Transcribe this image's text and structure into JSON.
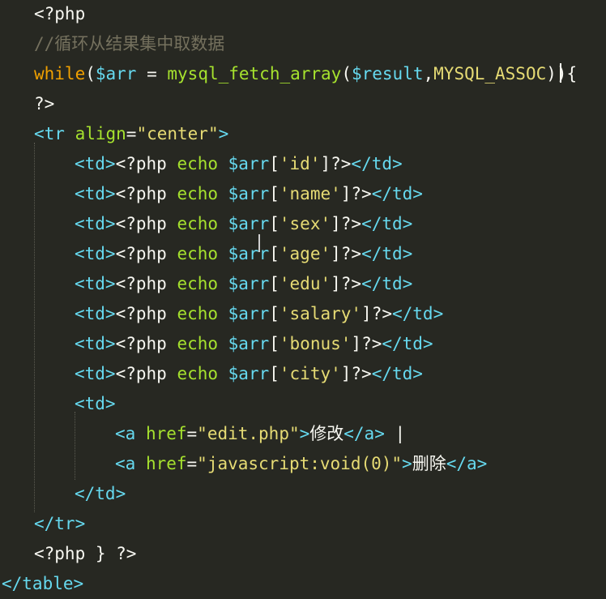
{
  "editor": {
    "theme": {
      "background": "#272822",
      "text": "#f8f8f2",
      "comment": "#75715e",
      "keyword": "#f0a000",
      "variable": "#66d9ef",
      "function": "#a6e22e",
      "tag": "#66d9ef",
      "attribute": "#a6e22e",
      "string": "#e6db74"
    },
    "lines": [
      {
        "indent": 1,
        "tokens": [
          {
            "t": "php",
            "v": "<?php"
          }
        ]
      },
      {
        "indent": 1,
        "tokens": [
          {
            "t": "comment",
            "v": "//循环从结果集中取数据"
          }
        ]
      },
      {
        "indent": 1,
        "tokens": [
          {
            "t": "kw",
            "v": "while"
          },
          {
            "t": "punct",
            "v": "("
          },
          {
            "t": "var",
            "v": "$arr"
          },
          {
            "t": "punct",
            "v": " = "
          },
          {
            "t": "fn",
            "v": "mysql_fetch_array"
          },
          {
            "t": "punct",
            "v": "("
          },
          {
            "t": "var",
            "v": "$result"
          },
          {
            "t": "punct",
            "v": ","
          },
          {
            "t": "str",
            "v": "MYSQL_ASSOC"
          },
          {
            "t": "punct",
            "v": ")){"
          }
        ]
      },
      {
        "indent": 1,
        "tokens": [
          {
            "t": "php",
            "v": "?>"
          }
        ]
      },
      {
        "indent": 1,
        "tokens": [
          {
            "t": "tag",
            "v": "<tr "
          },
          {
            "t": "attr",
            "v": "align"
          },
          {
            "t": "punct",
            "v": "="
          },
          {
            "t": "str",
            "v": "\"center\""
          },
          {
            "t": "tag",
            "v": ">"
          }
        ]
      },
      {
        "indent": 2,
        "tokens": [
          {
            "t": "tag",
            "v": "<td>"
          },
          {
            "t": "php",
            "v": "<?php "
          },
          {
            "t": "fn",
            "v": "echo "
          },
          {
            "t": "var",
            "v": "$arr"
          },
          {
            "t": "punct",
            "v": "["
          },
          {
            "t": "str",
            "v": "'id'"
          },
          {
            "t": "punct",
            "v": "]"
          },
          {
            "t": "php",
            "v": "?>"
          },
          {
            "t": "tag",
            "v": "</td>"
          }
        ]
      },
      {
        "indent": 2,
        "tokens": [
          {
            "t": "tag",
            "v": "<td>"
          },
          {
            "t": "php",
            "v": "<?php "
          },
          {
            "t": "fn",
            "v": "echo "
          },
          {
            "t": "var",
            "v": "$arr"
          },
          {
            "t": "punct",
            "v": "["
          },
          {
            "t": "str",
            "v": "'name'"
          },
          {
            "t": "punct",
            "v": "]"
          },
          {
            "t": "php",
            "v": "?>"
          },
          {
            "t": "tag",
            "v": "</td>"
          }
        ]
      },
      {
        "indent": 2,
        "tokens": [
          {
            "t": "tag",
            "v": "<td>"
          },
          {
            "t": "php",
            "v": "<?php "
          },
          {
            "t": "fn",
            "v": "echo "
          },
          {
            "t": "var",
            "v": "$arr"
          },
          {
            "t": "punct",
            "v": "["
          },
          {
            "t": "str",
            "v": "'sex'"
          },
          {
            "t": "punct",
            "v": "]"
          },
          {
            "t": "php",
            "v": "?>"
          },
          {
            "t": "tag",
            "v": "</td>"
          }
        ]
      },
      {
        "indent": 2,
        "tokens": [
          {
            "t": "tag",
            "v": "<td>"
          },
          {
            "t": "php",
            "v": "<?php "
          },
          {
            "t": "fn",
            "v": "echo "
          },
          {
            "t": "var",
            "v": "$arr"
          },
          {
            "t": "punct",
            "v": "["
          },
          {
            "t": "str",
            "v": "'age'"
          },
          {
            "t": "punct",
            "v": "]"
          },
          {
            "t": "php",
            "v": "?>"
          },
          {
            "t": "tag",
            "v": "</td>"
          }
        ]
      },
      {
        "indent": 2,
        "tokens": [
          {
            "t": "tag",
            "v": "<td>"
          },
          {
            "t": "php",
            "v": "<?php "
          },
          {
            "t": "fn",
            "v": "echo "
          },
          {
            "t": "var",
            "v": "$arr"
          },
          {
            "t": "punct",
            "v": "["
          },
          {
            "t": "str",
            "v": "'edu'"
          },
          {
            "t": "punct",
            "v": "]"
          },
          {
            "t": "php",
            "v": "?>"
          },
          {
            "t": "tag",
            "v": "</td>"
          }
        ]
      },
      {
        "indent": 2,
        "tokens": [
          {
            "t": "tag",
            "v": "<td>"
          },
          {
            "t": "php",
            "v": "<?php "
          },
          {
            "t": "fn",
            "v": "echo "
          },
          {
            "t": "var",
            "v": "$arr"
          },
          {
            "t": "punct",
            "v": "["
          },
          {
            "t": "str",
            "v": "'salary'"
          },
          {
            "t": "punct",
            "v": "]"
          },
          {
            "t": "php",
            "v": "?>"
          },
          {
            "t": "tag",
            "v": "</td>"
          }
        ]
      },
      {
        "indent": 2,
        "tokens": [
          {
            "t": "tag",
            "v": "<td>"
          },
          {
            "t": "php",
            "v": "<?php "
          },
          {
            "t": "fn",
            "v": "echo "
          },
          {
            "t": "var",
            "v": "$arr"
          },
          {
            "t": "punct",
            "v": "["
          },
          {
            "t": "str",
            "v": "'bonus'"
          },
          {
            "t": "punct",
            "v": "]"
          },
          {
            "t": "php",
            "v": "?>"
          },
          {
            "t": "tag",
            "v": "</td>"
          }
        ]
      },
      {
        "indent": 2,
        "tokens": [
          {
            "t": "tag",
            "v": "<td>"
          },
          {
            "t": "php",
            "v": "<?php "
          },
          {
            "t": "fn",
            "v": "echo "
          },
          {
            "t": "var",
            "v": "$arr"
          },
          {
            "t": "punct",
            "v": "["
          },
          {
            "t": "str",
            "v": "'city'"
          },
          {
            "t": "punct",
            "v": "]"
          },
          {
            "t": "php",
            "v": "?>"
          },
          {
            "t": "tag",
            "v": "</td>"
          }
        ]
      },
      {
        "indent": 2,
        "tokens": [
          {
            "t": "tag",
            "v": "<td>"
          }
        ]
      },
      {
        "indent": 3,
        "tokens": [
          {
            "t": "tag",
            "v": "<a "
          },
          {
            "t": "attr",
            "v": "href"
          },
          {
            "t": "punct",
            "v": "="
          },
          {
            "t": "str",
            "v": "\"edit.php\""
          },
          {
            "t": "tag",
            "v": ">"
          },
          {
            "t": "text",
            "v": "修改"
          },
          {
            "t": "tag",
            "v": "</a>"
          },
          {
            "t": "text",
            "v": " |"
          }
        ]
      },
      {
        "indent": 3,
        "tokens": [
          {
            "t": "tag",
            "v": "<a "
          },
          {
            "t": "attr",
            "v": "href"
          },
          {
            "t": "punct",
            "v": "="
          },
          {
            "t": "str",
            "v": "\"javascript:void(0)\""
          },
          {
            "t": "tag",
            "v": ">"
          },
          {
            "t": "text",
            "v": "删除"
          },
          {
            "t": "tag",
            "v": "</a>"
          }
        ]
      },
      {
        "indent": 2,
        "tokens": [
          {
            "t": "tag",
            "v": "</td>"
          }
        ]
      },
      {
        "indent": 1,
        "tokens": [
          {
            "t": "tag",
            "v": "</tr>"
          }
        ]
      },
      {
        "indent": 1,
        "tokens": [
          {
            "t": "php",
            "v": "<?php "
          },
          {
            "t": "punct",
            "v": "}"
          },
          {
            "t": "php",
            "v": " ?>"
          }
        ]
      },
      {
        "indent": 0,
        "tokens": [
          {
            "t": "tag",
            "v": "</table>"
          }
        ]
      }
    ]
  }
}
